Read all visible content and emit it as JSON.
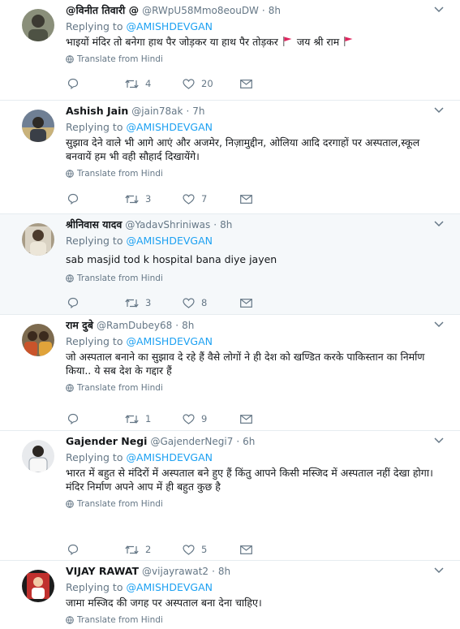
{
  "translate_label": "Translate from Hindi",
  "colors": {
    "link": "#1da1f2",
    "muted": "#657786",
    "text": "#14171a",
    "flag": "#e0245e"
  },
  "tweets": [
    {
      "display_name": "@विनीत तिवारी @",
      "handle": "@RWpU58Mmo8eouDW",
      "dot": "·",
      "time": "8h",
      "reply_prefix": "Replying to",
      "reply_to": "@AMISHDEVGAN",
      "text_a": "भाइयों मंदिर तो बनेगा हाथ पैर जोड़कर या हाथ पैर तोड़कर",
      "text_b": "जय श्री राम",
      "replies": "",
      "retweets": "4",
      "likes": "20",
      "avatar_icon": "user-avatar"
    },
    {
      "display_name": "Ashish Jain",
      "handle": "@jain78ak",
      "dot": "·",
      "time": "7h",
      "reply_prefix": "Replying to",
      "reply_to": "@AMISHDEVGAN",
      "lines": [
        "सुझाव देने वाले भी आगे आएं और अजमेर, निज़ामुद्दीन, ओलिया आदि दरगाहों पर अस्पताल,स्कूल बनवायें हम भी वही सौहार्द दिखायेंगे।"
      ],
      "replies": "",
      "retweets": "3",
      "likes": "7",
      "avatar_icon": "user-avatar"
    },
    {
      "display_name": "श्रीनिवास यादव",
      "handle": "@YadavShriniwas",
      "dot": "·",
      "time": "8h",
      "reply_prefix": "Replying to",
      "reply_to": "@AMISHDEVGAN",
      "lines": [
        "sab masjid tod k hospital bana diye jayen"
      ],
      "replies": "",
      "retweets": "3",
      "likes": "8",
      "avatar_icon": "user-avatar"
    },
    {
      "display_name": "राम दुबे",
      "handle": "@RamDubey68",
      "dot": "·",
      "time": "8h",
      "reply_prefix": "Replying to",
      "reply_to": "@AMISHDEVGAN",
      "lines": [
        "जो अस्पताल बनाने का सुझाव दे रहे हैं वैसे लोगों ने ही देश को खण्डित करके पाकिस्तान का निर्माण किया.. ये सब देश के गद्दार हैं"
      ],
      "replies": "",
      "retweets": "1",
      "likes": "9",
      "avatar_icon": "user-avatar"
    },
    {
      "display_name": "Gajender Negi",
      "handle": "@GajenderNegi7",
      "dot": "·",
      "time": "6h",
      "reply_prefix": "Replying to",
      "reply_to": "@AMISHDEVGAN",
      "lines": [
        "भारत में बहुत से मंदिरों में अस्पताल बने हुए हैं किंतु आपने किसी मस्जिद में अस्पताल नहीं देखा होगा।",
        "मंदिर निर्माण अपने आप में ही बहुत कुछ है"
      ],
      "replies": "",
      "retweets": "2",
      "likes": "5",
      "avatar_icon": "user-avatar"
    },
    {
      "display_name": "VIJAY RAWAT",
      "handle": "@vijayrawat2",
      "dot": "·",
      "time": "8h",
      "reply_prefix": "Replying to",
      "reply_to": "@AMISHDEVGAN",
      "lines": [
        "जामा मस्जिद की जगह पर अस्पताल बना देना चाहिए।"
      ],
      "translate_partial": "Translate from Hindi",
      "avatar_icon": "user-avatar"
    }
  ]
}
